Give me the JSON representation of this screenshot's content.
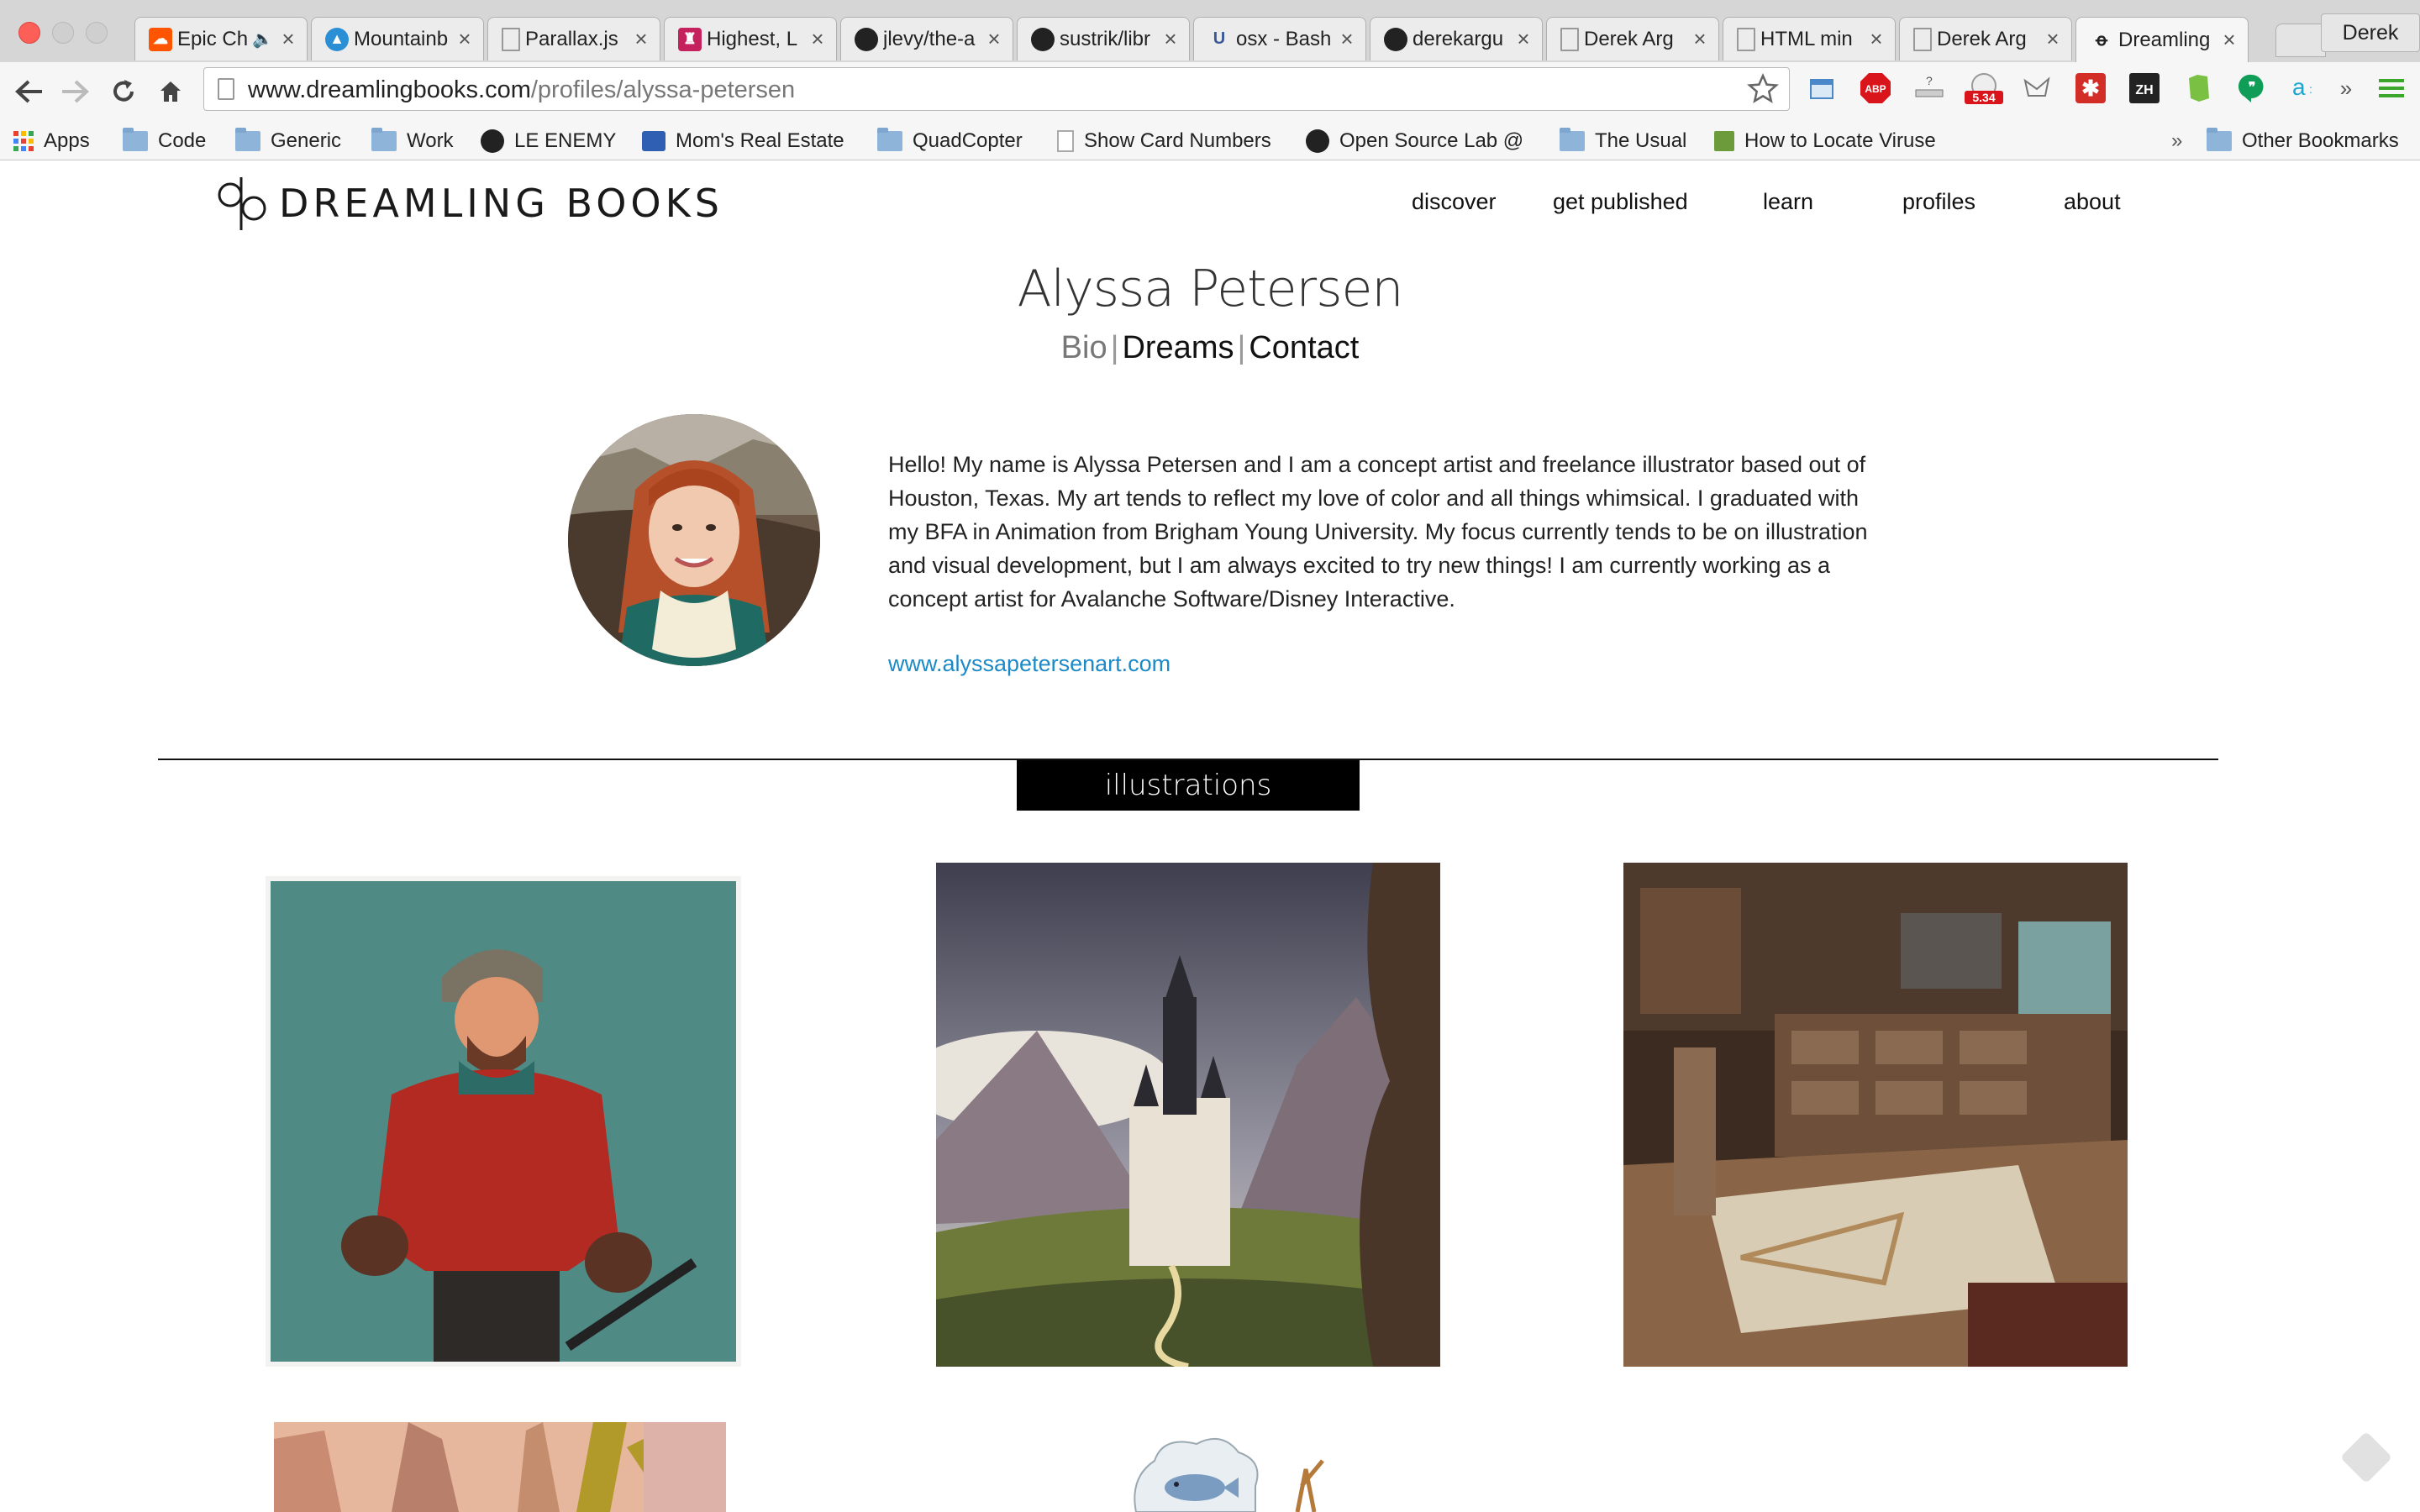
{
  "browser": {
    "profile_name": "Derek",
    "tabs": [
      {
        "label": "Epic Ch",
        "favicon": "soundcloud-icon",
        "color": "#ff5500",
        "audio": true
      },
      {
        "label": "Mountainb",
        "favicon": "mountain-icon",
        "color": "#2b8fd6"
      },
      {
        "label": "Parallax.js",
        "favicon": "page-icon",
        "color": "#ffffff"
      },
      {
        "label": "Highest, L",
        "favicon": "app-icon",
        "color": "#c4215d"
      },
      {
        "label": "jlevy/the-a",
        "favicon": "github-icon",
        "color": "#222222"
      },
      {
        "label": "sustrik/libr",
        "favicon": "github-icon",
        "color": "#222222"
      },
      {
        "label": "osx - Bash",
        "favicon": "unix-icon",
        "color": "#3b5998"
      },
      {
        "label": "derekargu",
        "favicon": "github-icon",
        "color": "#222222"
      },
      {
        "label": "Derek Arg",
        "favicon": "page-icon",
        "color": "#ffffff"
      },
      {
        "label": "HTML min",
        "favicon": "page-icon",
        "color": "#ffffff"
      },
      {
        "label": "Derek Arg",
        "favicon": "page-icon",
        "color": "#ffffff"
      },
      {
        "label": "Dreamling",
        "favicon": "dreamling-icon",
        "color": "#ffffff",
        "active": true
      }
    ],
    "tab_close_glyph": "×",
    "url_host": "www.dreamlingbooks.com",
    "url_path": "/profiles/alyssa-petersen",
    "extension_badge": "5.34",
    "extensions": [
      "calendar-icon",
      "adblock-icon",
      "scale-icon",
      "speed-icon",
      "butterfly-icon",
      "lastpass-icon",
      "zh-icon",
      "evernote-icon",
      "hangouts-icon",
      "amazon-icon",
      "overflow-icon",
      "menu-icon"
    ],
    "abp_label": "ABP",
    "zh_label": "ZH",
    "overflow_label": "»",
    "bookmarks": [
      {
        "label": "Apps",
        "icon": "apps"
      },
      {
        "label": "Code",
        "icon": "folder"
      },
      {
        "label": "Generic",
        "icon": "folder"
      },
      {
        "label": "Work",
        "icon": "folder"
      },
      {
        "label": "LE ENEMY",
        "icon": "github"
      },
      {
        "label": "Mom's Real Estate",
        "icon": "mls"
      },
      {
        "label": "QuadCopter",
        "icon": "folder"
      },
      {
        "label": "Show Card Numbers",
        "icon": "page"
      },
      {
        "label": "Open Source Lab @",
        "icon": "github"
      },
      {
        "label": "The Usual",
        "icon": "folder"
      },
      {
        "label": "How to Locate Viruse",
        "icon": "wh"
      }
    ],
    "bookmarks_overflow": "»",
    "other_bookmarks": "Other Bookmarks"
  },
  "site": {
    "logo_text": "DREAMLING BOOKS",
    "nav": [
      "discover",
      "get published",
      "learn",
      "profiles",
      "about"
    ],
    "profile_name": "Alyssa Petersen",
    "subnav": {
      "bio": "Bio",
      "dreams": "Dreams",
      "contact": "Contact",
      "separator": "|"
    },
    "bio": "Hello! My name is Alyssa Petersen and I am a concept artist and freelance illustrator based out of Houston, Texas. My art tends to reflect my love of color and all things whimsical. I graduated with my BFA in Animation from Brigham Young University. My focus currently tends to be on illustration and visual development, but I am always excited to try new things! I am currently working as a concept artist for Avalanche Software/Disney Interactive.",
    "website": "www.alyssapetersenart.com",
    "section_title": "illustrations",
    "colors": {
      "link": "#1c8ac6",
      "label_bg": "#000000"
    }
  }
}
